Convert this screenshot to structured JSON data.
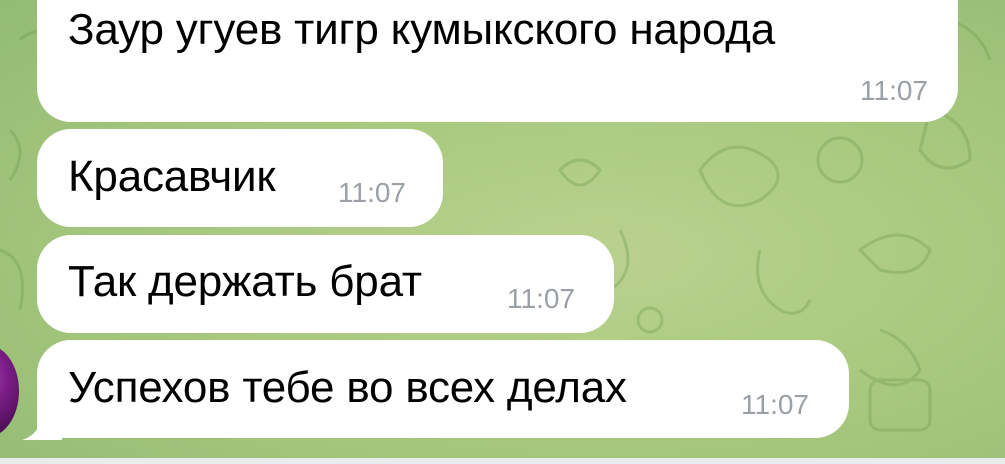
{
  "chat": {
    "messages": [
      {
        "text": "Заур угуев тигр кумыкского народа",
        "time": "11:07"
      },
      {
        "text": "Красавчик",
        "time": "11:07"
      },
      {
        "text": "Так держать брат",
        "time": "11:07"
      },
      {
        "text": "Успехов тебе во всех делах",
        "time": "11:07"
      }
    ]
  },
  "colors": {
    "bubble": "#ffffff",
    "timestamp": "#9aa0a6",
    "background": "#a9c97f",
    "avatar": "#7a1d86"
  }
}
